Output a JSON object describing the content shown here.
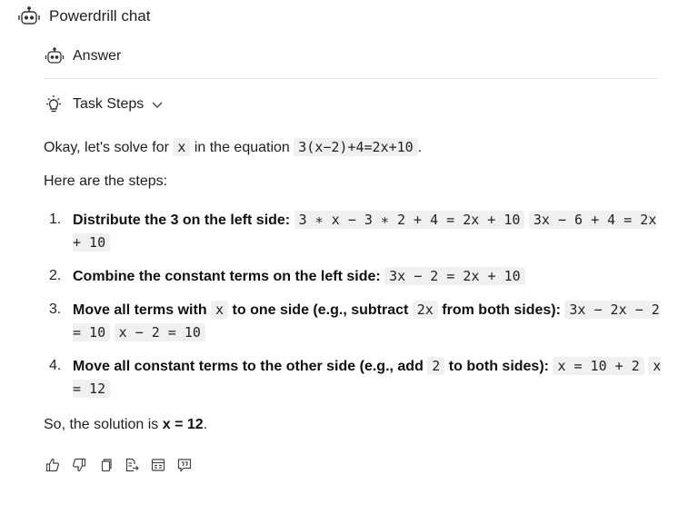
{
  "header": {
    "title": "Powerdrill chat",
    "icon": "robot-icon"
  },
  "answer": {
    "label": "Answer",
    "icon": "robot-icon"
  },
  "task_steps": {
    "label": "Task Steps",
    "icon": "lightbulb-icon",
    "toggle_icon": "chevron-down-icon"
  },
  "intro": {
    "text_a": "Okay, let's solve for ",
    "var": "x",
    "text_b": " in the equation ",
    "equation": "3(x−2)+4=2x+10",
    "text_c": "."
  },
  "steps_intro": "Here are the steps:",
  "steps": [
    {
      "num": "1.",
      "title": "Distribute the 3 on the left side:",
      "code": [
        "3 ∗ x − 3 ∗ 2 + 4 = 2x + 10",
        "3x − 6 + 4 = 2x + 10"
      ]
    },
    {
      "num": "2.",
      "title": "Combine the constant terms on the left side:",
      "code": [
        "3x − 2 = 2x + 10"
      ]
    },
    {
      "num": "3.",
      "title_a": "Move all terms with ",
      "title_var": "x",
      "title_b": " to one side (e.g., subtract ",
      "title_term": "2x",
      "title_c": " from both sides):",
      "code": [
        "3x − 2x − 2 = 10",
        "x − 2 = 10"
      ]
    },
    {
      "num": "4.",
      "title_a": "Move all constant terms to the other side (e.g., add ",
      "title_term": "2",
      "title_b": " to both sides):",
      "code": [
        "x = 10 + 2",
        "x = 12"
      ]
    }
  ],
  "conclusion": {
    "text": "So, the solution is ",
    "answer": "x = 12",
    "end": "."
  },
  "actions": [
    "thumbs-up-icon",
    "thumbs-down-icon",
    "copy-icon",
    "export-icon",
    "document-icon",
    "quote-icon"
  ]
}
